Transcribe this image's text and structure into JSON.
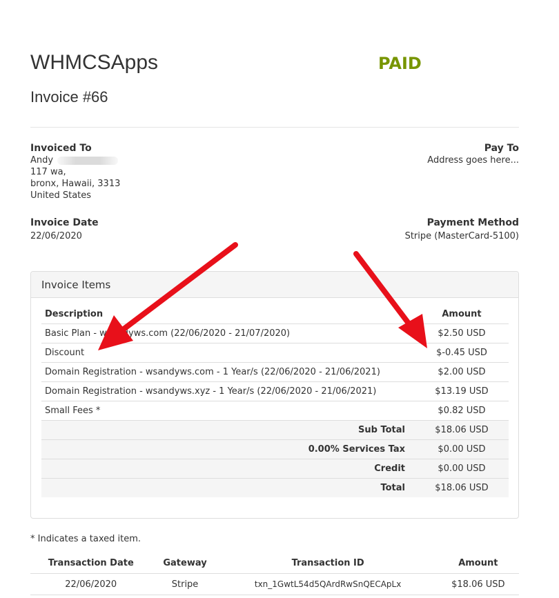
{
  "company": "WHMCSApps",
  "status": "PAID",
  "invoice_number": "Invoice #66",
  "invoiced_to": {
    "label": "Invoiced To",
    "name": "Andy",
    "address1": "117 wa,",
    "address2": "bronx, Hawaii, 3313",
    "country": "United States"
  },
  "pay_to": {
    "label": "Pay To",
    "address": "Address goes here..."
  },
  "invoice_date": {
    "label": "Invoice Date",
    "value": "22/06/2020"
  },
  "payment_method": {
    "label": "Payment Method",
    "value": "Stripe (MasterCard-5100)"
  },
  "items_panel": {
    "title": "Invoice Items",
    "col_description": "Description",
    "col_amount": "Amount",
    "items": [
      {
        "description": "Basic Plan - wsandyws.com (22/06/2020 - 21/07/2020)",
        "amount": "$2.50 USD"
      },
      {
        "description": "Discount",
        "amount": "$-0.45 USD"
      },
      {
        "description": "Domain Registration - wsandyws.com - 1 Year/s (22/06/2020 - 21/06/2021)",
        "amount": "$2.00 USD"
      },
      {
        "description": "Domain Registration - wsandyws.xyz - 1 Year/s (22/06/2020 - 21/06/2021)",
        "amount": "$13.19 USD"
      },
      {
        "description": "Small Fees *",
        "amount": "$0.82 USD"
      }
    ],
    "summary": [
      {
        "label": "Sub Total",
        "amount": "$18.06 USD"
      },
      {
        "label": "0.00% Services Tax",
        "amount": "$0.00 USD"
      },
      {
        "label": "Credit",
        "amount": "$0.00 USD"
      },
      {
        "label": "Total",
        "amount": "$18.06 USD"
      }
    ]
  },
  "taxed_note": "* Indicates a taxed item.",
  "transactions": {
    "col_date": "Transaction Date",
    "col_gateway": "Gateway",
    "col_id": "Transaction ID",
    "col_amount": "Amount",
    "rows": [
      {
        "date": "22/06/2020",
        "gateway": "Stripe",
        "id": "txn_1GwtL54d5QArdRwSnQECApLx",
        "amount": "$18.06 USD"
      }
    ]
  },
  "colors": {
    "paid_green": "#779500",
    "arrow_red": "#e8101a"
  }
}
